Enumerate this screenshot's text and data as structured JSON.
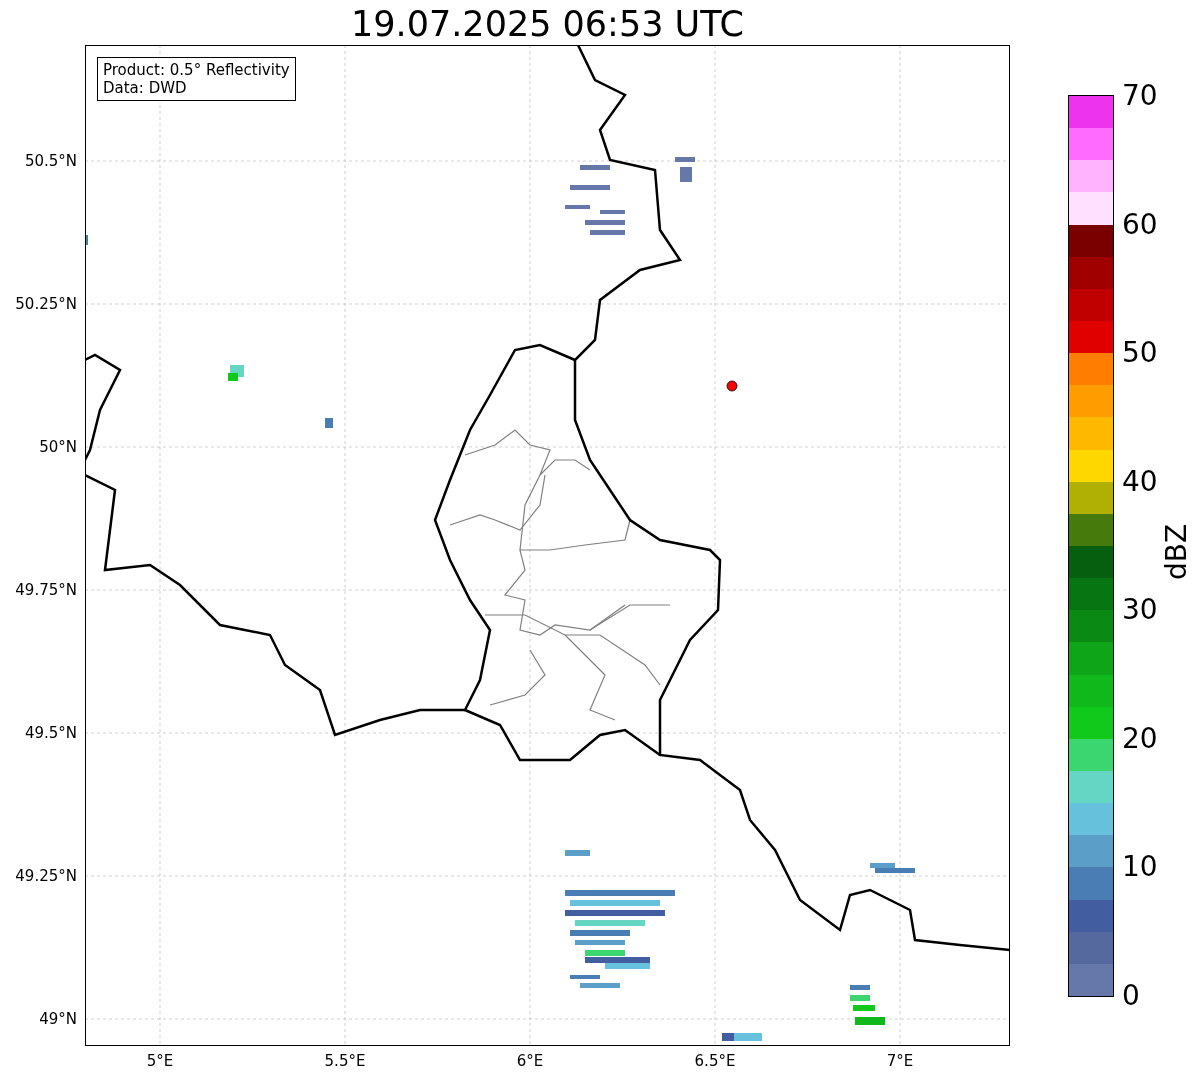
{
  "title": "19.07.2025 06:53 UTC",
  "info_box": [
    "Product: 0.5° Reflectivity",
    "Data: DWD"
  ],
  "x_ticks": [
    "5°E",
    "5.5°E",
    "6°E",
    "6.5°E",
    "7°E"
  ],
  "y_ticks": [
    "50.5°N",
    "50.25°N",
    "50°N",
    "49.75°N",
    "49.5°N",
    "49.25°N",
    "49°N"
  ],
  "colorbar": {
    "label": "dBZ",
    "ticks": [
      "70",
      "60",
      "50",
      "40",
      "30",
      "20",
      "10",
      "0"
    ],
    "bands": [
      {
        "color": "#ee33ee"
      },
      {
        "color": "#ff6bff"
      },
      {
        "color": "#ffb3ff"
      },
      {
        "color": "#ffe0ff"
      },
      {
        "color": "#7a0000"
      },
      {
        "color": "#a00000"
      },
      {
        "color": "#c00000"
      },
      {
        "color": "#e00000"
      },
      {
        "color": "#ff7d00"
      },
      {
        "color": "#ff9d00"
      },
      {
        "color": "#ffb800"
      },
      {
        "color": "#ffd700"
      },
      {
        "color": "#b0b004"
      },
      {
        "color": "#477a0c"
      },
      {
        "color": "#065f0f"
      },
      {
        "color": "#077612"
      },
      {
        "color": "#0a8a14"
      },
      {
        "color": "#0ea519"
      },
      {
        "color": "#10b81c"
      },
      {
        "color": "#11c91a"
      },
      {
        "color": "#3cd670"
      },
      {
        "color": "#66d6c4"
      },
      {
        "color": "#66c1dc"
      },
      {
        "color": "#5b9ec8"
      },
      {
        "color": "#4a7db3"
      },
      {
        "color": "#435ea0"
      },
      {
        "color": "#55699f"
      },
      {
        "color": "#6677aa"
      }
    ]
  }
}
